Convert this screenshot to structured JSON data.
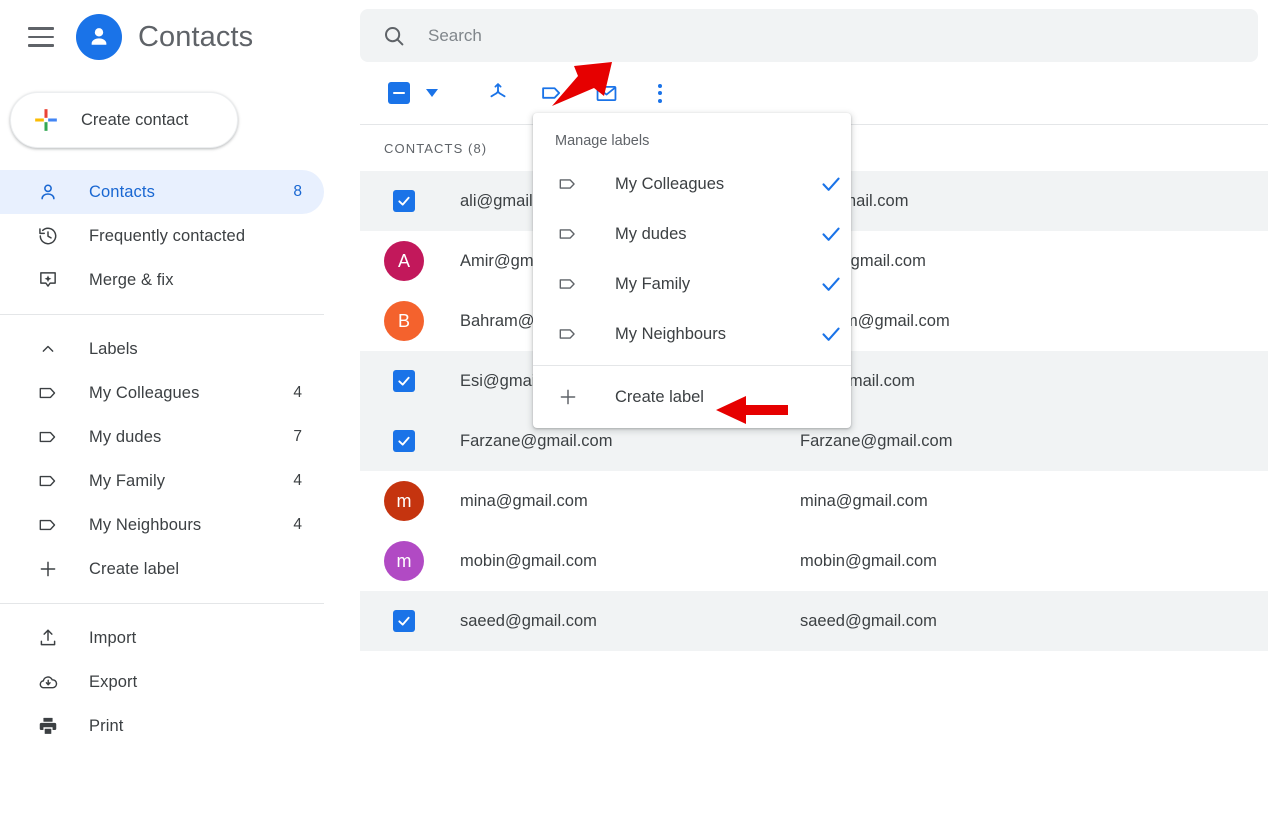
{
  "app": {
    "title": "Contacts",
    "menu_icon": "hamburger-icon",
    "logo_icon": "contacts-person-logo"
  },
  "sidebar": {
    "create_contact": {
      "label": "Create contact",
      "icon": "plus-icon"
    },
    "nav": [
      {
        "label": "Contacts",
        "count": "8",
        "icon": "person-icon",
        "active": true
      },
      {
        "label": "Frequently contacted",
        "count": "",
        "icon": "history-icon",
        "active": false
      },
      {
        "label": "Merge & fix",
        "count": "",
        "icon": "merge-fix-icon",
        "active": false
      }
    ],
    "labels_header": {
      "label": "Labels",
      "icon": "chevron-up-icon"
    },
    "labels": [
      {
        "label": "My Colleagues",
        "count": "4",
        "icon": "label-tag-icon"
      },
      {
        "label": "My dudes",
        "count": "7",
        "icon": "label-tag-icon"
      },
      {
        "label": "My Family",
        "count": "4",
        "icon": "label-tag-icon"
      },
      {
        "label": "My Neighbours",
        "count": "4",
        "icon": "label-tag-icon"
      }
    ],
    "create_label": {
      "label": "Create label",
      "icon": "plus-icon"
    },
    "actions": [
      {
        "label": "Import",
        "icon": "import-upload-icon"
      },
      {
        "label": "Export",
        "icon": "export-cloud-download-icon"
      },
      {
        "label": "Print",
        "icon": "printer-icon"
      }
    ]
  },
  "search": {
    "placeholder": "Search",
    "value": "",
    "icon": "search-icon"
  },
  "toolbar": {
    "select_all_state": "indeterminate",
    "select_all_icon": "checkbox-indeterminate-icon",
    "dropdown_icon": "caret-down-icon",
    "buttons": [
      {
        "name": "merge-button",
        "icon": "merge-icon"
      },
      {
        "name": "manage-labels-button",
        "icon": "label-tag-icon"
      },
      {
        "name": "send-email-button",
        "icon": "envelope-icon"
      },
      {
        "name": "more-options-button",
        "icon": "kebab-menu-icon"
      }
    ]
  },
  "list": {
    "header": "CONTACTS (8)",
    "rows": [
      {
        "name": "ali@gmail.com",
        "email": "ali@gmail.com",
        "selected": true,
        "avatar_letter": "",
        "avatar_color": ""
      },
      {
        "name": "Amir@gmail.com",
        "email": "Amir@gmail.com",
        "selected": false,
        "avatar_letter": "A",
        "avatar_color": "#c2185b"
      },
      {
        "name": "Bahram@gmail.com",
        "email": "Bahram@gmail.com",
        "selected": false,
        "avatar_letter": "B",
        "avatar_color": "#f4622d"
      },
      {
        "name": "Esi@gmail.com",
        "email": "Esi@gmail.com",
        "selected": true,
        "avatar_letter": "",
        "avatar_color": ""
      },
      {
        "name": "Farzane@gmail.com",
        "email": "Farzane@gmail.com",
        "selected": true,
        "avatar_letter": "",
        "avatar_color": ""
      },
      {
        "name": "mina@gmail.com",
        "email": "mina@gmail.com",
        "selected": false,
        "avatar_letter": "m",
        "avatar_color": "#c5340f"
      },
      {
        "name": "mobin@gmail.com",
        "email": "mobin@gmail.com",
        "selected": false,
        "avatar_letter": "m",
        "avatar_color": "#b14ac4"
      },
      {
        "name": "saeed@gmail.com",
        "email": "saeed@gmail.com",
        "selected": true,
        "avatar_letter": "",
        "avatar_color": ""
      }
    ]
  },
  "labels_menu": {
    "title": "Manage labels",
    "items": [
      {
        "label": "My Colleagues",
        "checked": true,
        "icon": "label-tag-icon"
      },
      {
        "label": "My dudes",
        "checked": true,
        "icon": "label-tag-icon"
      },
      {
        "label": "My Family",
        "checked": true,
        "icon": "label-tag-icon"
      },
      {
        "label": "My Neighbours",
        "checked": true,
        "icon": "label-tag-icon"
      }
    ],
    "create": {
      "label": "Create label",
      "icon": "plus-icon"
    }
  },
  "annotations": {
    "arrow_color": "#e60000",
    "arrow_toolbar_target": "manage-labels-button",
    "arrow_create_target": "create-label-menu-item"
  },
  "colors": {
    "accent_blue": "#1a73e8",
    "active_pill": "#e8f0fe",
    "row_selected": "#f1f3f4",
    "text_primary": "#3c4043",
    "text_secondary": "#5f6368"
  }
}
